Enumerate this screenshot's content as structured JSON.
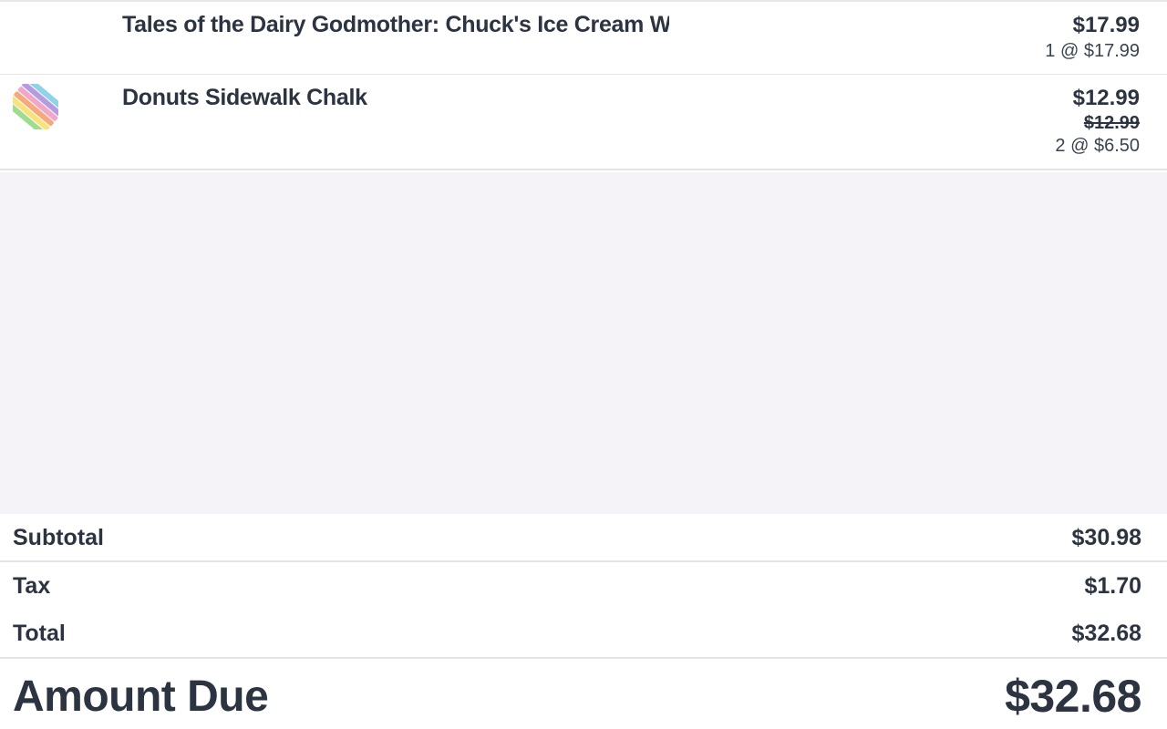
{
  "cart": {
    "items": [
      {
        "name": "Tales of the Dairy Godmother: Chuck's Ice Cream Wi",
        "price": "$17.99",
        "unit": "1 @ $17.99",
        "has_image": false
      },
      {
        "name": "Donuts Sidewalk Chalk",
        "price": "$12.99",
        "original_price": "$12.99",
        "unit": "2 @ $6.50",
        "has_image": true,
        "image_icon": "sidewalk-chalk-thumbnail"
      }
    ]
  },
  "totals": {
    "subtotal_label": "Subtotal",
    "subtotal_value": "$30.98",
    "tax_label": "Tax",
    "tax_value": "$1.70",
    "total_label": "Total",
    "total_value": "$32.68",
    "amount_due_label": "Amount Due",
    "amount_due_value": "$32.68"
  },
  "colors": {
    "text": "#2b3440",
    "empty_area": "#f5f2f8",
    "divider": "#e3e4ea"
  }
}
